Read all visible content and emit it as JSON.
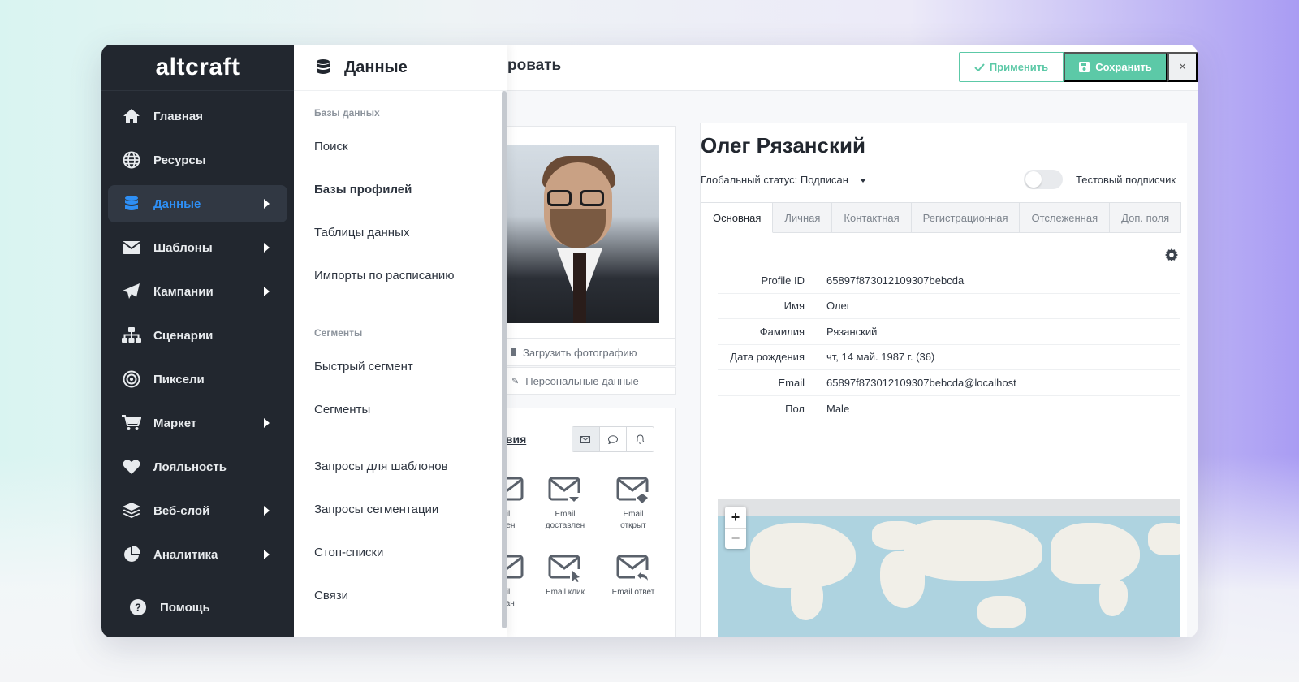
{
  "app": {
    "logo": "altcraft"
  },
  "sidebar": {
    "items": [
      {
        "label": "Главная",
        "icon": "home-icon",
        "arrow": false
      },
      {
        "label": "Ресурсы",
        "icon": "globe-icon",
        "arrow": false
      },
      {
        "label": "Данные",
        "icon": "database-icon",
        "arrow": true,
        "active": true
      },
      {
        "label": "Шаблоны",
        "icon": "envelope-icon",
        "arrow": true
      },
      {
        "label": "Кампании",
        "icon": "paper-plane-icon",
        "arrow": true
      },
      {
        "label": "Сценарии",
        "icon": "sitemap-icon",
        "arrow": false
      },
      {
        "label": "Пиксели",
        "icon": "target-icon",
        "arrow": false
      },
      {
        "label": "Маркет",
        "icon": "cart-icon",
        "arrow": true
      },
      {
        "label": "Лояльность",
        "icon": "heart-icon",
        "arrow": false
      },
      {
        "label": "Веб-слой",
        "icon": "layers-icon",
        "arrow": true
      },
      {
        "label": "Аналитика",
        "icon": "pie-chart-icon",
        "arrow": true
      }
    ],
    "help": "Помощь"
  },
  "submenu": {
    "title": "Данные",
    "section_databases": "Базы данных",
    "item_search": "Поиск",
    "item_profile_bases": "Базы профилей",
    "item_data_tables": "Таблицы данных",
    "item_scheduled_imports": "Импорты по расписанию",
    "section_segments": "Сегменты",
    "item_quick_segment": "Быстрый сегмент",
    "item_segments": "Сегменты",
    "item_template_queries": "Запросы для шаблонов",
    "item_segmentation_queries": "Запросы сегментации",
    "item_stop_lists": "Стоп-списки",
    "item_links": "Связи"
  },
  "topbar": {
    "title_partial": "ровать",
    "apply": "Применить",
    "save": "Сохранить",
    "close": "×"
  },
  "left_panel": {
    "upload_photo": "Загрузить фотографию",
    "personal_data": "Персональные данные",
    "actions_title": "твия",
    "events": [
      {
        "label": "il\nлен"
      },
      {
        "label": "Email\nдоставлен"
      },
      {
        "label": "Email\nоткрыт"
      },
      {
        "label": "il\nтан"
      },
      {
        "label": "Email клик"
      },
      {
        "label": "Email ответ"
      }
    ]
  },
  "profile": {
    "name": "Олег Рязанский",
    "global_status_label": "Глобальный статус:",
    "global_status_value": "Подписан",
    "test_subscriber": "Тестовый подписчик",
    "tabs": [
      "Основная",
      "Личная",
      "Контактная",
      "Регистрационная",
      "Отслеженная",
      "Доп. поля"
    ],
    "fields": [
      {
        "label": "Profile ID",
        "value": "65897f873012109307bebcda"
      },
      {
        "label": "Имя",
        "value": "Олег"
      },
      {
        "label": "Фамилия",
        "value": "Рязанский"
      },
      {
        "label": "Дата рождения",
        "value": "чт, 14 май. 1987 г. (36)"
      },
      {
        "label": "Email",
        "value": "65897f873012109307bebcda@localhost"
      },
      {
        "label": "Пол",
        "value": "Male"
      }
    ],
    "map_zoom_in": "+",
    "map_zoom_out": "−"
  },
  "colors": {
    "sidebar_bg": "#22272f",
    "accent_blue": "#2e8ff5",
    "accent_green": "#5cc9a7"
  }
}
